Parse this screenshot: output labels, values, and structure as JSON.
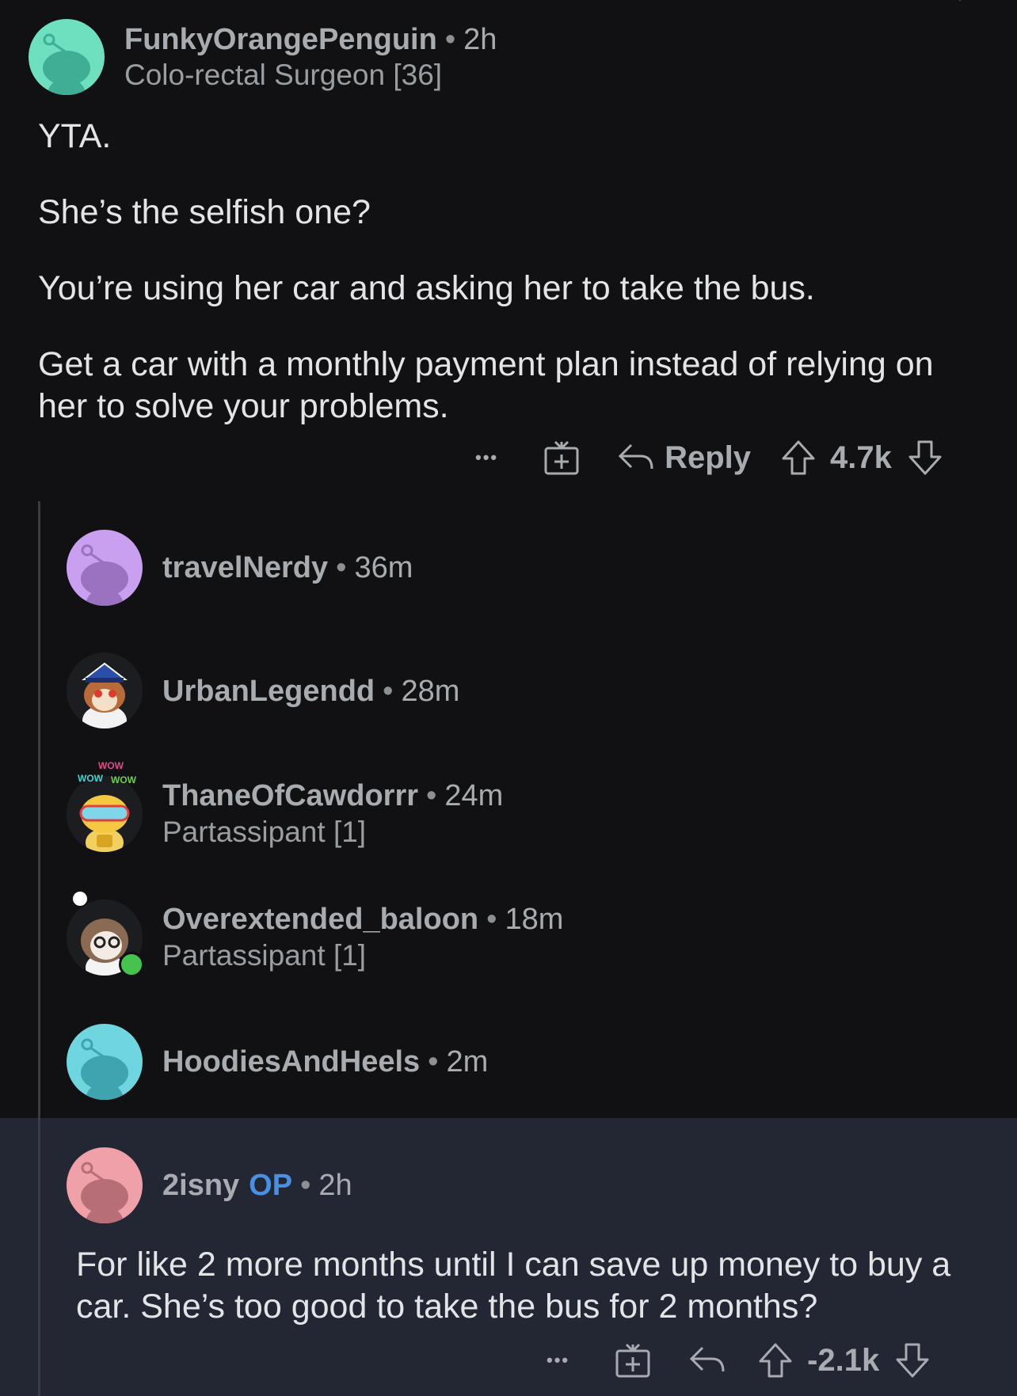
{
  "comments": [
    {
      "username": "FunkyOrangePenguin",
      "time": "2h",
      "flair": "Colo-rectal Surgeon [36]",
      "body": [
        "YTA.",
        "She’s the selfish one?",
        "You’re using her car and asking her to take the bus.",
        "Get a car with a monthly payment plan instead of relying on her to solve your problems."
      ],
      "actions": {
        "more": "•••",
        "reply_label": "Reply",
        "score": "4.7k"
      },
      "avatar_color": "#6ee0c0"
    },
    {
      "username": "travelNerdy",
      "time": "36m",
      "avatar_color": "#c9a0f0"
    },
    {
      "username": "UrbanLegendd",
      "time": "28m"
    },
    {
      "username": "ThaneOfCawdorrr",
      "time": "24m",
      "flair": "Partassipant [1]",
      "avatar_text": [
        "WOW",
        "WOW",
        "WOW"
      ]
    },
    {
      "username": "Overextended_baloon",
      "time": "18m",
      "flair": "Partassipant [1]"
    },
    {
      "username": "HoodiesAndHeels",
      "time": "2m",
      "avatar_color": "#6fd6e0"
    },
    {
      "username": "2isny",
      "op_label": "OP",
      "time": "2h",
      "body": [
        "For like 2 more months until I can save up money to buy a car. She’s too good to take the bus for 2 months?"
      ],
      "actions": {
        "more": "•••",
        "score": "-2.1k"
      },
      "avatar_color": "#f0a0a8"
    }
  ],
  "icons": {
    "chevron": "chevron-down-icon",
    "gift": "gift-icon",
    "reply": "reply-arrow-icon",
    "upvote": "upvote-arrow-icon",
    "downvote": "downvote-arrow-icon"
  },
  "colors": {
    "background": "#111113",
    "highlight": "#232633",
    "op_accent": "#4a8fe0",
    "online": "#46c24f"
  }
}
